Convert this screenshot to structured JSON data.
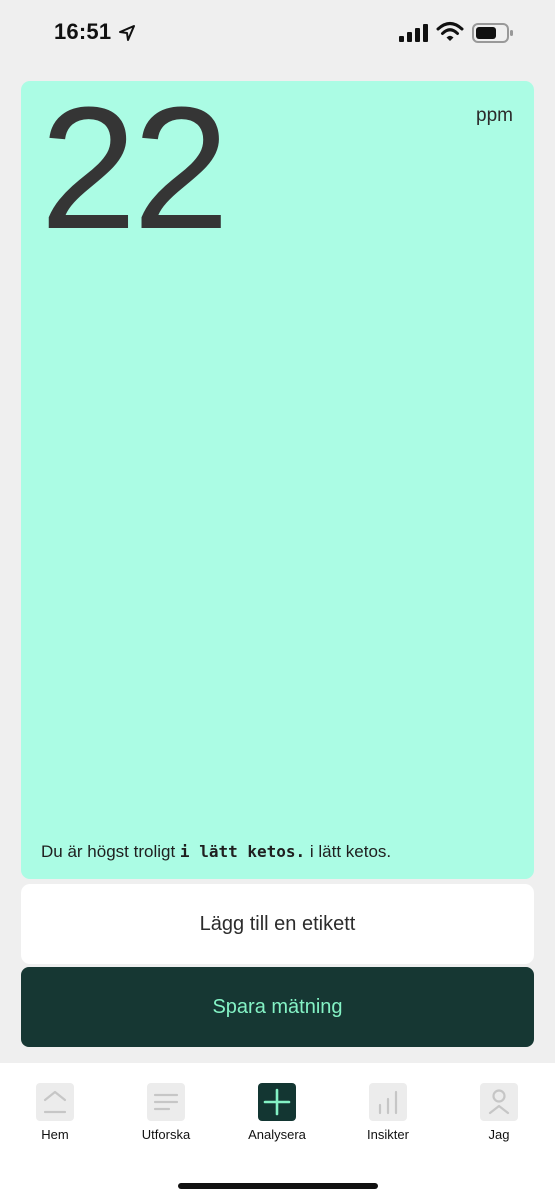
{
  "status_bar": {
    "time": "16:51",
    "icons": [
      "location-arrow-icon",
      "cellular-signal-icon",
      "wifi-icon",
      "battery-icon"
    ]
  },
  "reading": {
    "value": "22",
    "unit": "ppm",
    "message_prefix": "Du är högst troligt",
    "message_emphasis": "i lätt ketos.",
    "message_suffix": "i lätt ketos.",
    "background_color": "#abfce4"
  },
  "actions": {
    "add_label": "Lägg till en etikett",
    "save": "Spara mätning",
    "save_background": "#163733",
    "save_text_color": "#84f2c5"
  },
  "tabs": [
    {
      "label": "Hem",
      "icon": "home-icon",
      "active": false
    },
    {
      "label": "Utforska",
      "icon": "list-icon",
      "active": false
    },
    {
      "label": "Analysera",
      "icon": "plus-icon",
      "active": true
    },
    {
      "label": "Insikter",
      "icon": "bar-chart-icon",
      "active": false
    },
    {
      "label": "Jag",
      "icon": "profile-icon",
      "active": false
    }
  ]
}
